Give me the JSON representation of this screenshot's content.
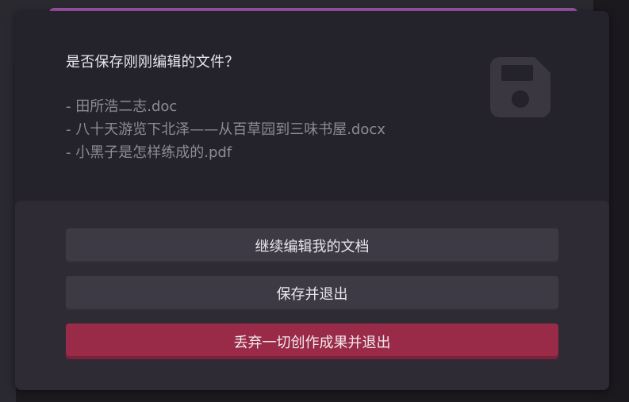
{
  "dialog": {
    "question": "是否保存刚刚编辑的文件？",
    "files": [
      "- 田所浩二志.doc",
      "- 八十天游览下北泽——从百草园到三味书屋.docx",
      "- 小黑子是怎样练成的.pdf"
    ],
    "icon": "save-icon",
    "buttons": {
      "continue_label": "继续编辑我的文档",
      "save_label": "保存并退出",
      "discard_label": "丢弃一切创作成果并退出"
    }
  },
  "colors": {
    "dialog_bg": "#24222a",
    "actions_bg": "#2e2b34",
    "button_bg": "#3e3a45",
    "danger": "#992a48",
    "accent": "#9a56a4"
  }
}
